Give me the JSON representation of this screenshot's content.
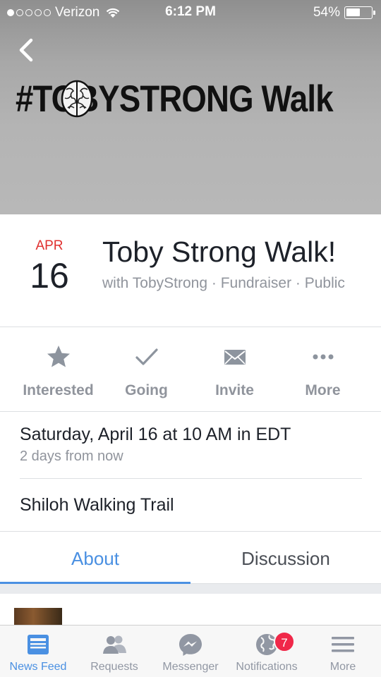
{
  "status_bar": {
    "carrier": "Verizon",
    "time": "6:12 PM",
    "battery": "54%",
    "battery_level": 0.54,
    "signal_bars_filled": 1,
    "signal_bars_total": 5
  },
  "cover": {
    "title": "#TOBYSTRONG Walk",
    "back_icon": "chevron-left-icon",
    "brain_icon": "brain-icon"
  },
  "event": {
    "month": "APR",
    "day": "16",
    "title": "Toby Strong Walk!",
    "subtitle": "with TobyStrong · Fundraiser · Public"
  },
  "actions": [
    {
      "label": "Interested",
      "icon": "star-icon"
    },
    {
      "label": "Going",
      "icon": "checkmark-icon"
    },
    {
      "label": "Invite",
      "icon": "envelope-icon"
    },
    {
      "label": "More",
      "icon": "ellipsis-icon"
    }
  ],
  "details": {
    "when": "Saturday, April 16 at 10 AM in EDT",
    "when_relative": "2 days from now",
    "where": "Shiloh Walking Trail"
  },
  "tabs": [
    {
      "label": "About",
      "active": true
    },
    {
      "label": "Discussion",
      "active": false
    }
  ],
  "tabbar": [
    {
      "label": "News Feed",
      "icon": "news-feed-icon",
      "active": true
    },
    {
      "label": "Requests",
      "icon": "friends-icon",
      "active": false
    },
    {
      "label": "Messenger",
      "icon": "messenger-icon",
      "active": false
    },
    {
      "label": "Notifications",
      "icon": "globe-icon",
      "active": false,
      "badge": "7"
    },
    {
      "label": "More",
      "icon": "menu-icon",
      "active": false
    }
  ],
  "colors": {
    "accent": "#4a90e2",
    "date_red": "#e0302f",
    "badge_red": "#f02849",
    "muted": "#90949c"
  }
}
